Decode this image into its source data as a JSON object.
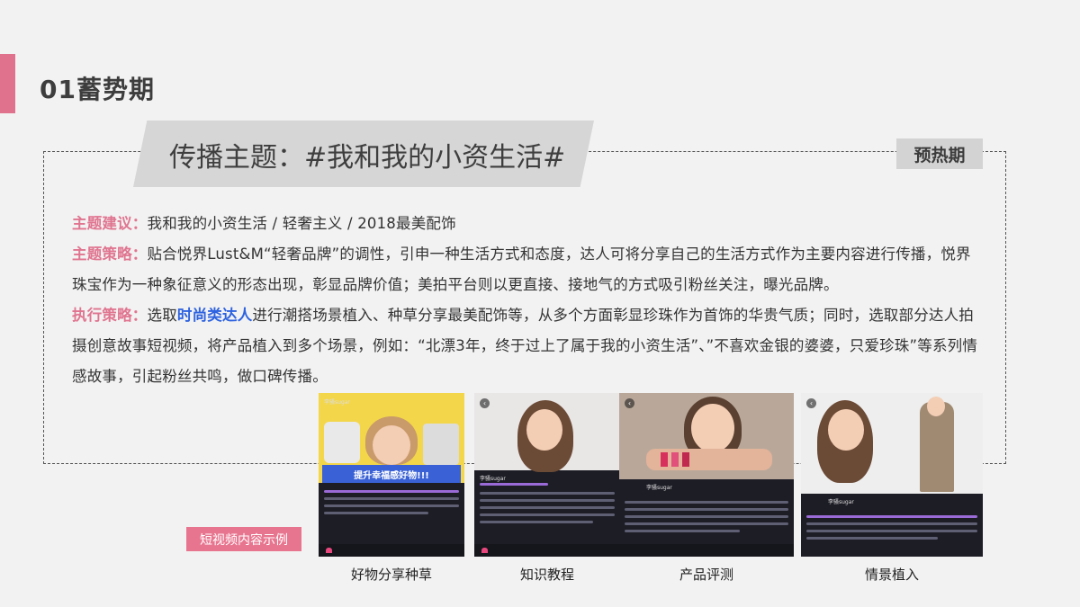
{
  "section": {
    "title": "01蓄势期"
  },
  "theme": {
    "text": "传播主题：#我和我的小资生活#"
  },
  "phase_tag": "预热期",
  "paragraphs": {
    "suggestion_label": "主题建议：",
    "suggestion_text": "我和我的小资生活 / 轻奢主义 / 2018最美配饰",
    "strategy_label": "主题策略：",
    "strategy_text": "贴合悦界Lust&M“轻奢品牌”的调性，引申一种生活方式和态度，达人可将分享自己的生活方式作为主要内容进行传播，悦界珠宝作为一种象征意义的形态出现，彰显品牌价值；美拍平台则以更直接、接地气的方式吸引粉丝关注，曝光品牌。",
    "execution_label": "执行策略：",
    "execution_pre": "选取",
    "execution_highlight": "时尚类达人",
    "execution_post": "进行潮搭场景植入、种草分享最美配饰等，从多个方面彰显珍珠作为首饰的华贵气质；同时，选取部分达人拍摄创意故事短视频，将产品植入到多个场景，例如：“北漂3年，终于过上了属于我的小资生活”、”不喜欢金银的婆婆，只爱珍珠”等系列情感故事，引起粉丝共鸣，做口碑传播。"
  },
  "example_tag": "短视频内容示例",
  "examples": [
    {
      "caption": "好物分享种草",
      "user": "李骚sugar",
      "overlay": "提升幸福感好物!!!"
    },
    {
      "caption": "知识教程",
      "user": "李骚sugar"
    },
    {
      "caption": "产品评测",
      "user": "李骚sugar"
    },
    {
      "caption": "情景植入",
      "user": "李骚sugar"
    }
  ],
  "colors": {
    "accent": "#e0728e",
    "highlight": "#2d62e0",
    "banner": "#d6d6d6"
  }
}
